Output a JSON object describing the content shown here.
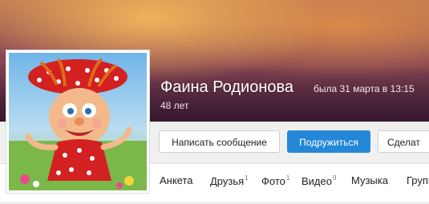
{
  "profile": {
    "name": "Фаина Родионова",
    "last_seen": "была 31 марта в 13:15",
    "age": "48 лет"
  },
  "actions": {
    "message_label": "Написать сообщение",
    "add_friend_label": "Подружиться",
    "more_label": "Сделат"
  },
  "nav": {
    "items": [
      {
        "label": "Анкета",
        "count": ""
      },
      {
        "label": "Друзья",
        "count": "1"
      },
      {
        "label": "Фото",
        "count": "1"
      },
      {
        "label": "Видео",
        "count": "9"
      },
      {
        "label": "Музыка",
        "count": ""
      },
      {
        "label": "Групп",
        "count": ""
      }
    ]
  },
  "colors": {
    "accent_button": "#2587d8",
    "cover_top": "#c07a52",
    "cover_bottom": "#4a2340"
  }
}
